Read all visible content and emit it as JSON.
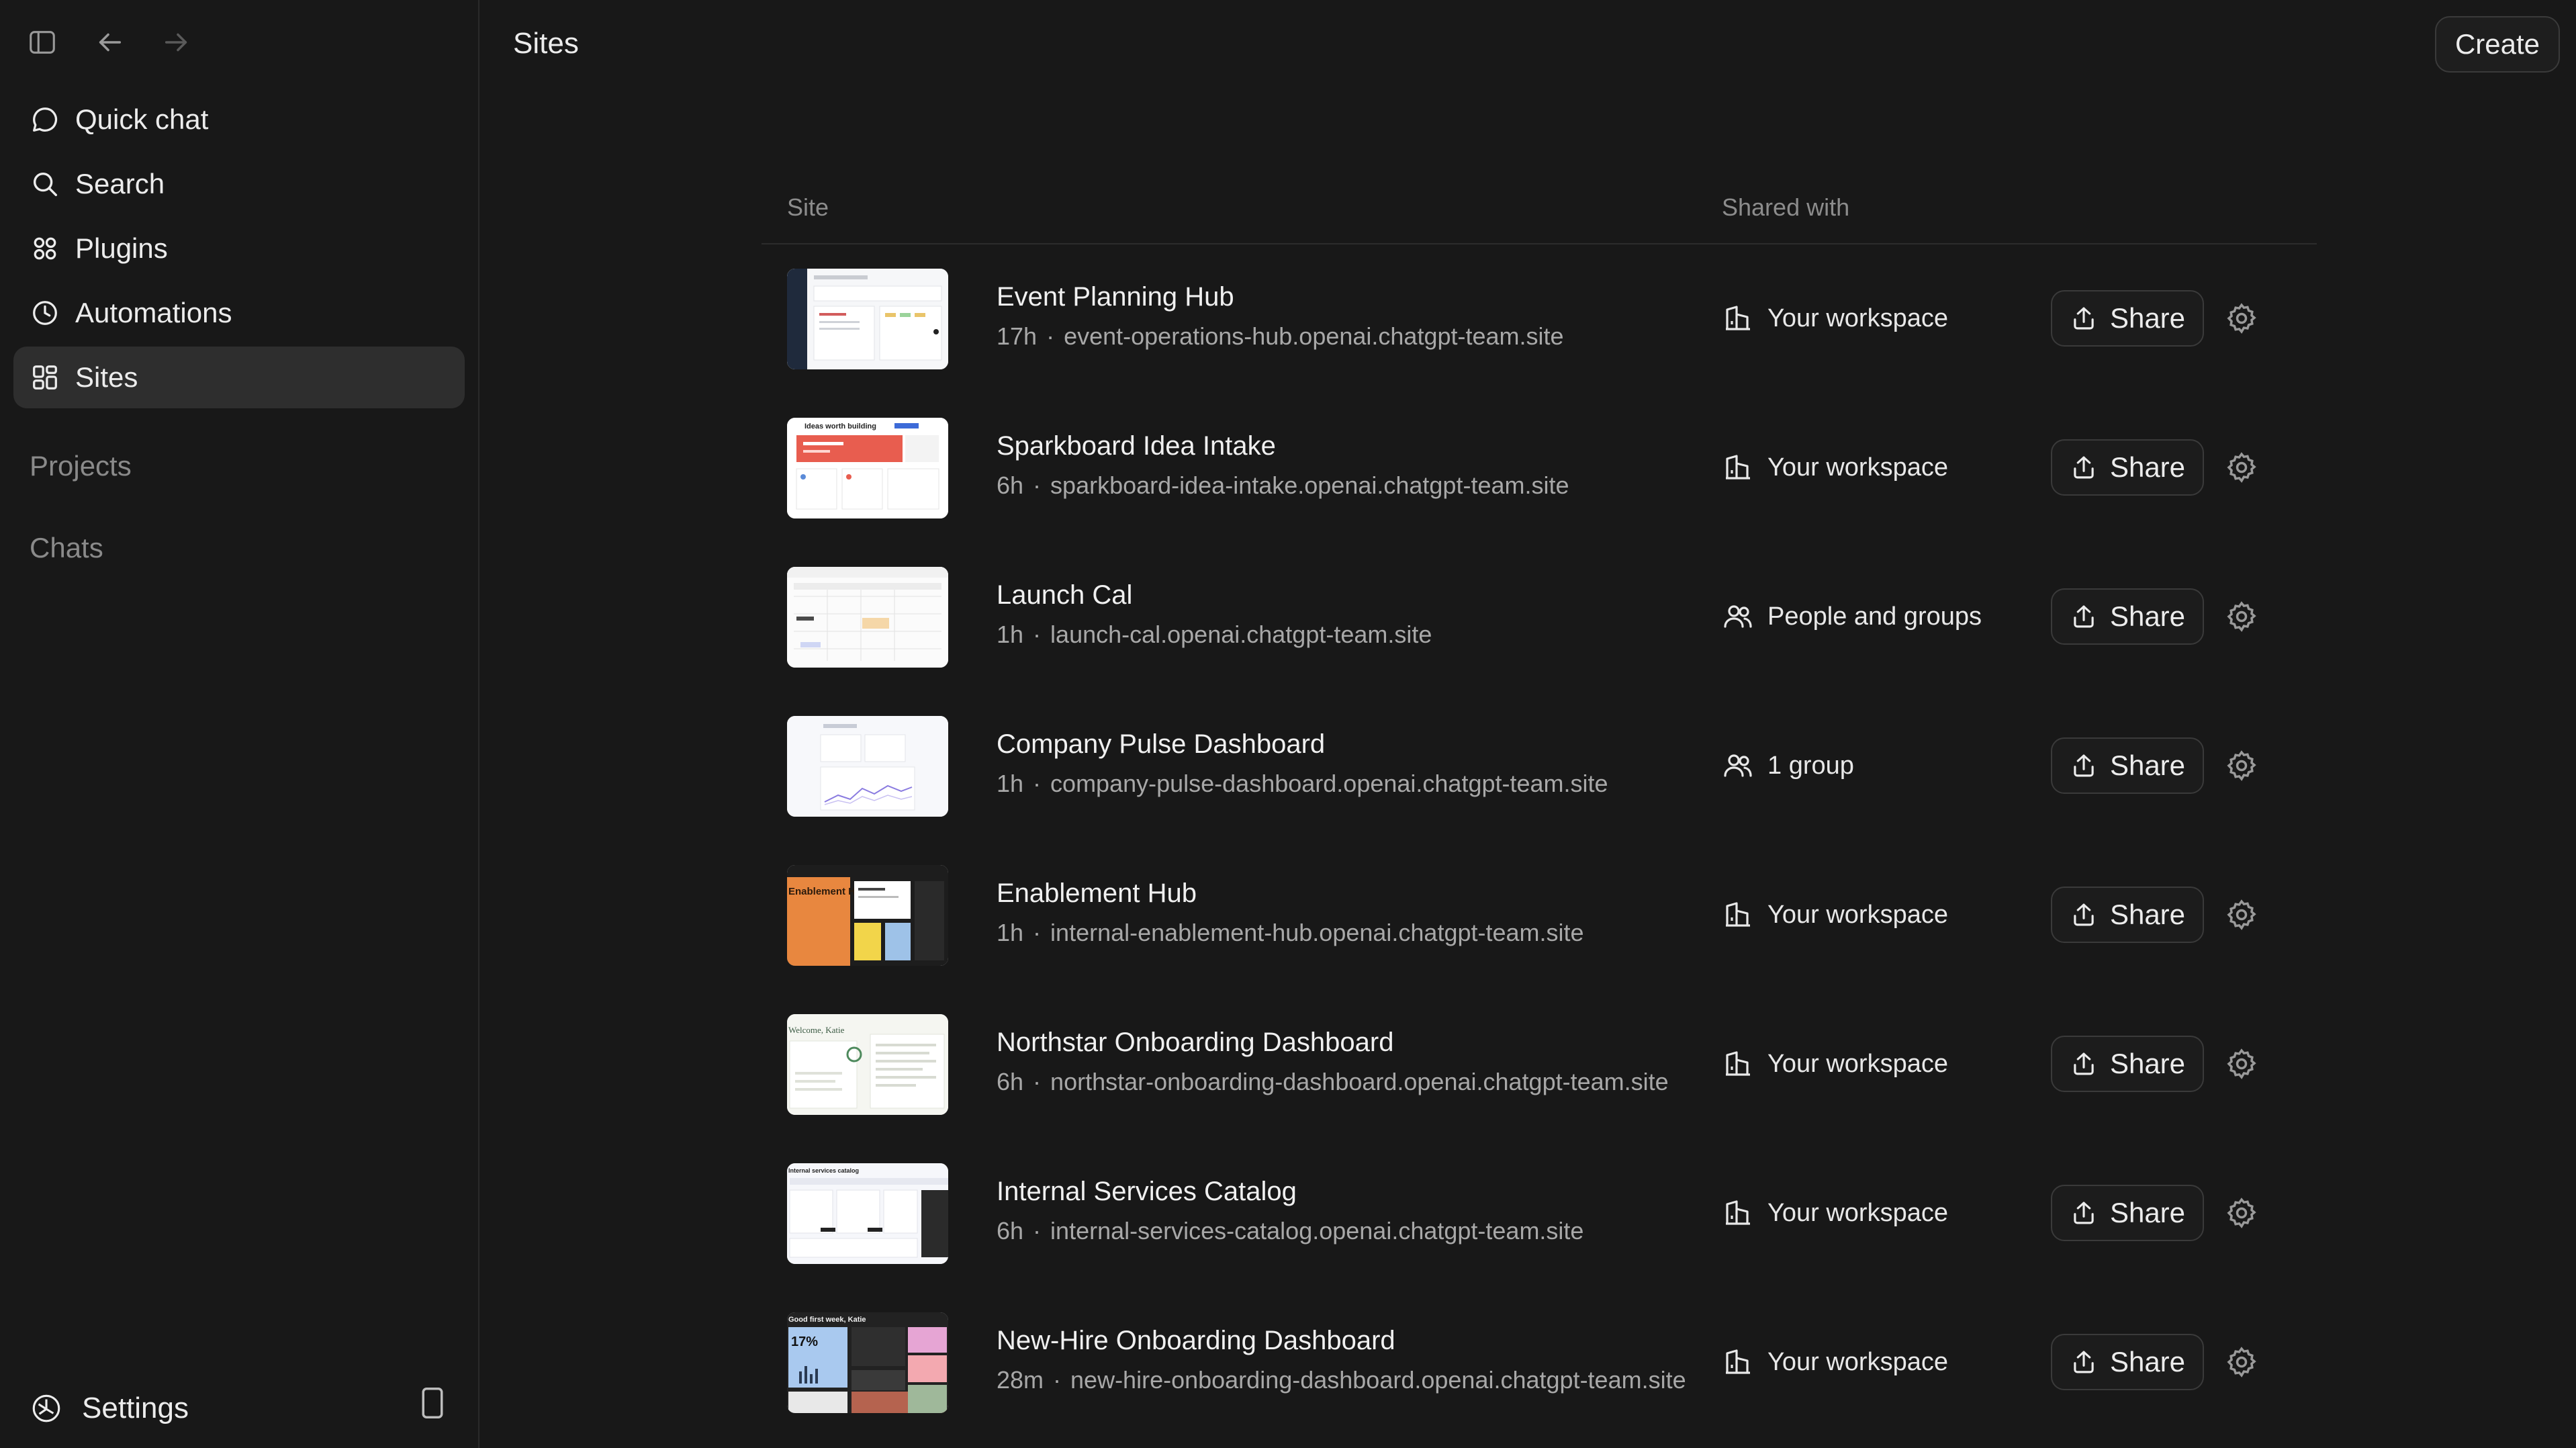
{
  "page": {
    "title": "Sites",
    "create_label": "Create"
  },
  "sidebar": {
    "items": [
      {
        "label": "Quick chat",
        "icon": "chat-bubble-icon"
      },
      {
        "label": "Search",
        "icon": "search-icon"
      },
      {
        "label": "Plugins",
        "icon": "plugins-grid-icon"
      },
      {
        "label": "Automations",
        "icon": "clock-icon"
      },
      {
        "label": "Sites",
        "icon": "sites-layout-icon",
        "active": true
      }
    ],
    "projects_label": "Projects",
    "chats_label": "Chats",
    "settings_label": "Settings"
  },
  "table": {
    "col_site": "Site",
    "col_shared": "Shared with",
    "share_label": "Share",
    "rows": [
      {
        "title": "Event Planning Hub",
        "age": "17h",
        "url": "event-operations-hub.openai.chatgpt-team.site",
        "shared": "Your workspace",
        "shared_icon": "building-icon"
      },
      {
        "title": "Sparkboard Idea Intake",
        "age": "6h",
        "url": "sparkboard-idea-intake.openai.chatgpt-team.site",
        "shared": "Your workspace",
        "shared_icon": "building-icon"
      },
      {
        "title": "Launch Cal",
        "age": "1h",
        "url": "launch-cal.openai.chatgpt-team.site",
        "shared": "People and groups",
        "shared_icon": "people-icon"
      },
      {
        "title": "Company Pulse Dashboard",
        "age": "1h",
        "url": "company-pulse-dashboard.openai.chatgpt-team.site",
        "shared": "1 group",
        "shared_icon": "people-icon"
      },
      {
        "title": "Enablement Hub",
        "age": "1h",
        "url": "internal-enablement-hub.openai.chatgpt-team.site",
        "shared": "Your workspace",
        "shared_icon": "building-icon"
      },
      {
        "title": "Northstar Onboarding Dashboard",
        "age": "6h",
        "url": "northstar-onboarding-dashboard.openai.chatgpt-team.site",
        "shared": "Your workspace",
        "shared_icon": "building-icon"
      },
      {
        "title": "Internal Services Catalog",
        "age": "6h",
        "url": "internal-services-catalog.openai.chatgpt-team.site",
        "shared": "Your workspace",
        "shared_icon": "building-icon"
      },
      {
        "title": "New-Hire Onboarding Dashboard",
        "age": "28m",
        "url": "new-hire-onboarding-dashboard.openai.chatgpt-team.site",
        "shared": "Your workspace",
        "shared_icon": "building-icon"
      }
    ]
  },
  "thumbnails": {
    "sparkboard_heading": "Ideas worth building",
    "enablement_heading": "Enablement Hub",
    "northstar_heading": "Welcome, Katie",
    "services_heading": "Internal services catalog",
    "newhire_heading": "Good first week, Katie",
    "newhire_stat": "17%"
  },
  "colors": {
    "background": "#181818",
    "sidebar_active": "#2e2e2e",
    "text_primary": "#ececec",
    "text_muted": "#8a8a8a"
  }
}
